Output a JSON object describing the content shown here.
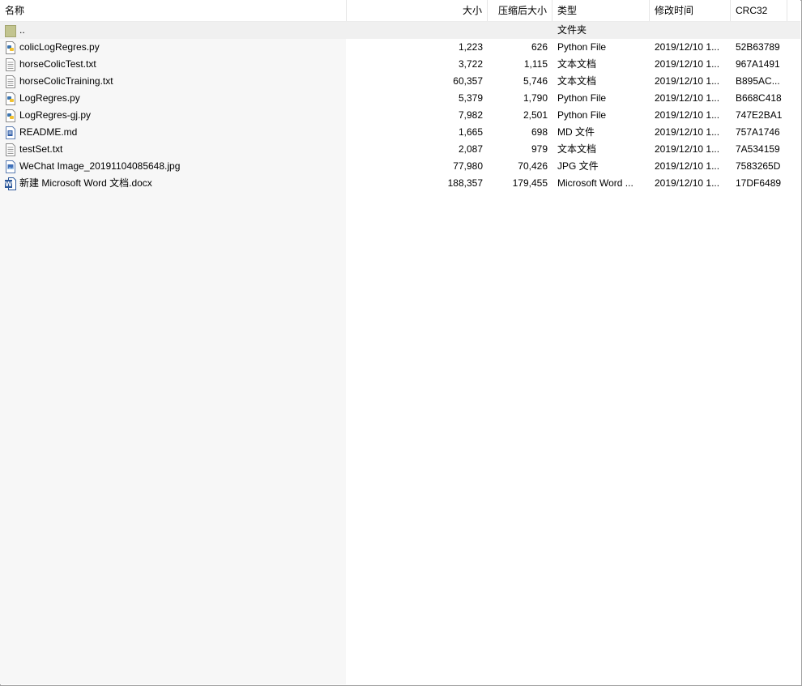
{
  "columns": {
    "name": "名称",
    "size": "大小",
    "packed": "压缩后大小",
    "type": "类型",
    "modified": "修改时间",
    "crc": "CRC32"
  },
  "sort_indicator": "^",
  "parent_row": {
    "name": "..",
    "type": "文件夹",
    "icon": "folder-icon"
  },
  "files": [
    {
      "name": "colicLogRegres.py",
      "size": "1,223",
      "packed": "626",
      "type": "Python File",
      "modified": "2019/12/10 1...",
      "crc": "52B63789",
      "icon": "python-file-icon"
    },
    {
      "name": "horseColicTest.txt",
      "size": "3,722",
      "packed": "1,115",
      "type": "文本文档",
      "modified": "2019/12/10 1...",
      "crc": "967A1491",
      "icon": "text-file-icon"
    },
    {
      "name": "horseColicTraining.txt",
      "size": "60,357",
      "packed": "5,746",
      "type": "文本文档",
      "modified": "2019/12/10 1...",
      "crc": "B895AC...",
      "icon": "text-file-icon"
    },
    {
      "name": "LogRegres.py",
      "size": "5,379",
      "packed": "1,790",
      "type": "Python File",
      "modified": "2019/12/10 1...",
      "crc": "B668C418",
      "icon": "python-file-icon"
    },
    {
      "name": "LogRegres-gj.py",
      "size": "7,982",
      "packed": "2,501",
      "type": "Python File",
      "modified": "2019/12/10 1...",
      "crc": "747E2BA1",
      "icon": "python-file-icon"
    },
    {
      "name": "README.md",
      "size": "1,665",
      "packed": "698",
      "type": "MD 文件",
      "modified": "2019/12/10 1...",
      "crc": "757A1746",
      "icon": "md-file-icon"
    },
    {
      "name": "testSet.txt",
      "size": "2,087",
      "packed": "979",
      "type": "文本文档",
      "modified": "2019/12/10 1...",
      "crc": "7A534159",
      "icon": "text-file-icon"
    },
    {
      "name": "WeChat Image_20191104085648.jpg",
      "size": "77,980",
      "packed": "70,426",
      "type": "JPG 文件",
      "modified": "2019/12/10 1...",
      "crc": "7583265D",
      "icon": "image-file-icon"
    },
    {
      "name": "新建 Microsoft Word 文档.docx",
      "size": "188,357",
      "packed": "179,455",
      "type": "Microsoft Word ...",
      "modified": "2019/12/10 1...",
      "crc": "17DF6489",
      "icon": "word-file-icon"
    }
  ]
}
